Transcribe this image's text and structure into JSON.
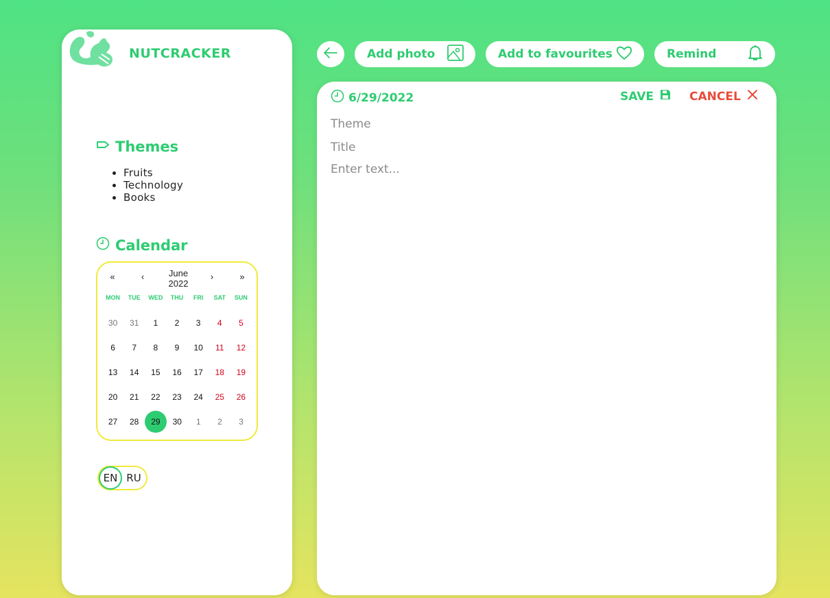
{
  "brand": {
    "name": "NUTCRACKER",
    "logo_icon": "squirrel-icon"
  },
  "themes": {
    "title": "Themes",
    "items": [
      "Fruits",
      "Technology",
      "Books"
    ]
  },
  "calendar": {
    "title": "Calendar",
    "nav": {
      "first": "«",
      "prev": "‹",
      "next": "›",
      "last": "»"
    },
    "month": "June",
    "year": "2022",
    "weekdays": [
      "MON",
      "TUE",
      "WED",
      "THU",
      "FRI",
      "SAT",
      "SUN"
    ],
    "weeks": [
      [
        "30",
        "31",
        "1",
        "2",
        "3",
        "4",
        "5"
      ],
      [
        "6",
        "7",
        "8",
        "9",
        "10",
        "11",
        "12"
      ],
      [
        "13",
        "14",
        "15",
        "16",
        "17",
        "18",
        "19"
      ],
      [
        "20",
        "21",
        "22",
        "23",
        "24",
        "25",
        "26"
      ],
      [
        "27",
        "28",
        "29",
        "30",
        "1",
        "2",
        "3"
      ]
    ],
    "selected_day": "29"
  },
  "language": {
    "en": "EN",
    "ru": "RU",
    "active": "EN"
  },
  "toolbar": {
    "add_photo": "Add photo",
    "add_favourites": "Add to favourites",
    "remind": "Remind"
  },
  "editor": {
    "date": "6/29/2022",
    "save": "SAVE",
    "cancel": "CANCEL",
    "theme_placeholder": "Theme",
    "title_placeholder": "Title",
    "text_placeholder": "Enter text..."
  },
  "colors": {
    "accent": "#2ecc71",
    "danger": "#e74c3c",
    "weekend": "#d0021b",
    "border": "#f0ea3a"
  }
}
